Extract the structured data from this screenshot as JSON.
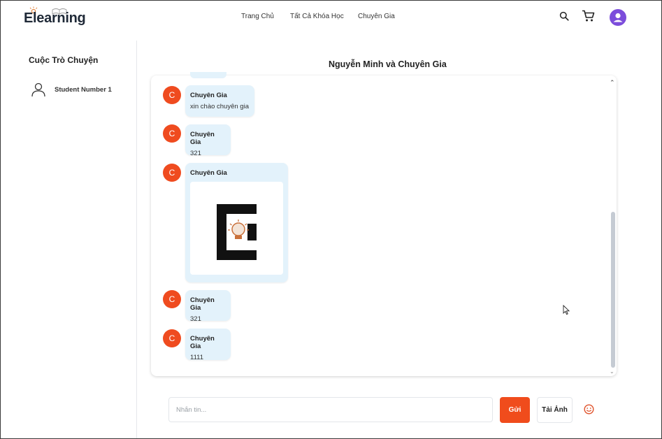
{
  "header": {
    "logo_text": "Elearning",
    "nav": [
      "Trang Chủ",
      "Tất Cả Khóa Học",
      "Chuyên Gia"
    ],
    "icons": [
      "search-icon",
      "cart-icon",
      "account-icon"
    ],
    "accent_color": "#7c4ddb"
  },
  "sidebar": {
    "title": "Cuộc Trò Chuyện",
    "users": [
      {
        "name": "Student Number 1",
        "icon": "user-icon"
      }
    ]
  },
  "chat": {
    "title": "Nguyễn Minh và Chuyên Gia",
    "messages": [
      {
        "avatar": "C",
        "sender": "Chuyên Gia",
        "text": "xin chào chuyên gia"
      },
      {
        "avatar": "C",
        "sender": "Chuyên Gia",
        "text": "321"
      },
      {
        "avatar": "C",
        "sender": "Chuyên Gia",
        "image": "elearning-logo-image"
      },
      {
        "avatar": "C",
        "sender": "Chuyên Gia",
        "text": "321"
      },
      {
        "avatar": "C",
        "sender": "Chuyên Gia",
        "text": "1111"
      }
    ]
  },
  "composer": {
    "placeholder": "Nhắn tin...",
    "send_label": "Gửi",
    "upload_label": "Tải Ảnh",
    "emoji_icon": "smiley-icon",
    "send_color": "#f04c1c"
  }
}
